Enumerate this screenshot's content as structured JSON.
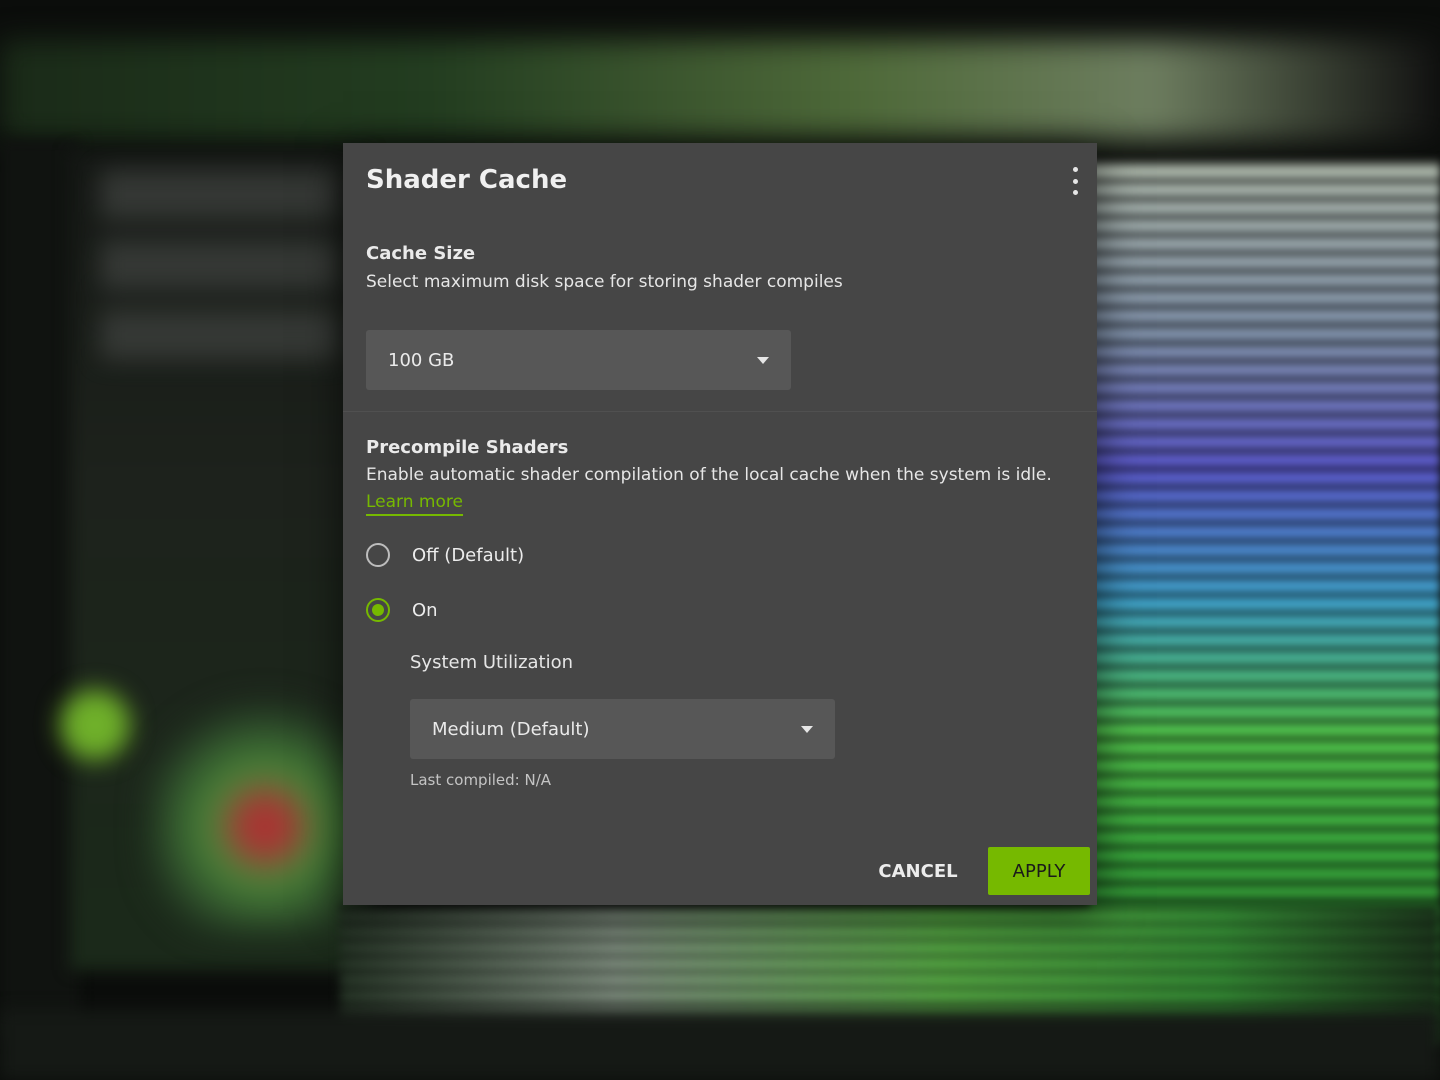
{
  "dialog": {
    "title": "Shader Cache",
    "cache_size": {
      "heading": "Cache Size",
      "description": "Select maximum disk space for storing shader compiles",
      "selected": "100 GB"
    },
    "precompile": {
      "heading": "Precompile Shaders",
      "description": "Enable automatic shader compilation of the local cache when the system is idle.",
      "learn_more": "Learn more",
      "options": [
        {
          "label": "Off (Default)",
          "checked": false
        },
        {
          "label": "On",
          "checked": true
        }
      ],
      "system_utilization": {
        "heading": "System Utilization",
        "selected": "Medium (Default)"
      },
      "last_compiled": "Last compiled: N/A"
    },
    "buttons": {
      "cancel": "CANCEL",
      "apply": "APPLY"
    }
  },
  "colors": {
    "accent": "#76b900",
    "dialog_bg": "#464646",
    "select_bg": "#575757"
  },
  "icons": {
    "menu": "kebab-vertical-icon",
    "dropdown": "caret-down-icon"
  }
}
